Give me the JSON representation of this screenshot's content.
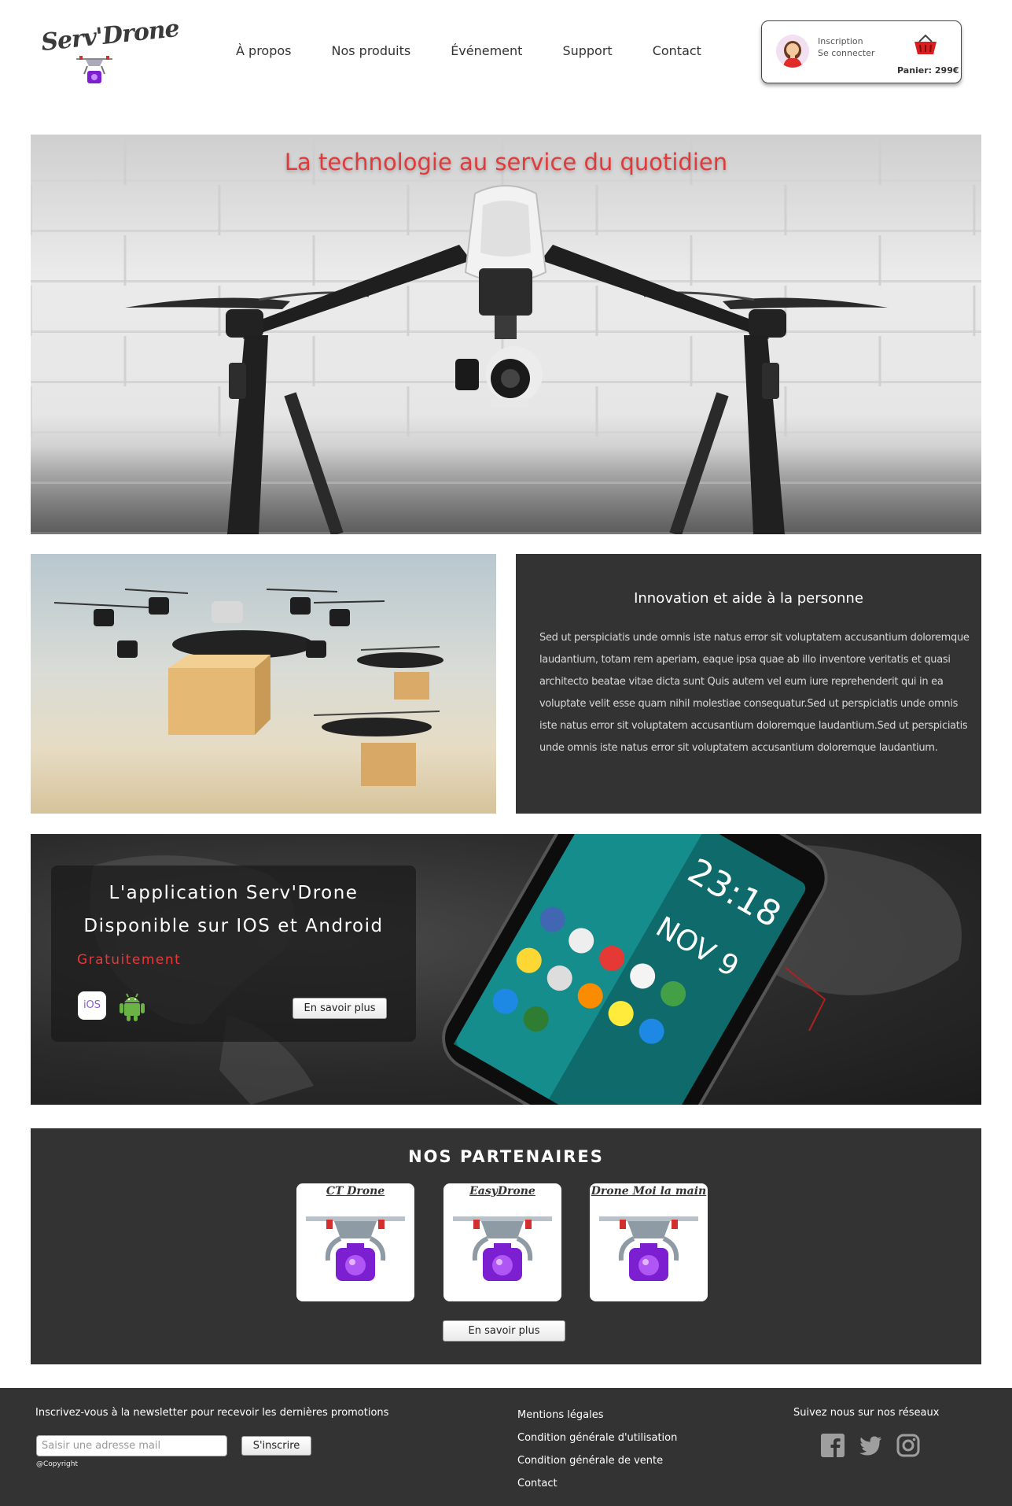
{
  "header": {
    "logo_text": "Serv'Drone",
    "nav": [
      "À propos",
      "Nos produits",
      "Événement",
      "Support",
      "Contact"
    ],
    "account": {
      "signup_label": "Inscription",
      "login_label": "Se connecter",
      "cart_total": "Panier: 299€"
    }
  },
  "hero": {
    "title": "La technologie au service du quotidien"
  },
  "info": {
    "title": "Innovation et aide à la personne",
    "text": "Sed ut perspiciatis unde omnis iste natus error sit voluptatem accusantium doloremque laudantium, totam rem aperiam, eaque ipsa quae ab illo inventore veritatis et quasi architecto beatae vitae dicta sunt Quis autem vel eum iure reprehenderit qui in ea voluptate velit esse quam nihil molestiae consequatur.Sed ut perspiciatis unde omnis iste natus error sit voluptatem accusantium doloremque laudantium.Sed ut perspiciatis unde omnis iste natus error sit voluptatem accusantium doloremque laudantium."
  },
  "app": {
    "line1": "L'application Serv'Drone",
    "line2": "Disponible sur IOS et Android",
    "free": "Gratuitement",
    "ios_label": "iOS",
    "button": "En savoir plus",
    "phone_time": "23:18",
    "phone_date": "NOV 9"
  },
  "partners": {
    "title": "NOS PARTENAIRES",
    "items": [
      "CT Drone",
      "EasyDrone",
      "Drone Moi la main"
    ],
    "button": "En savoir plus"
  },
  "footer": {
    "newsletter_text": "Inscrivez-vous à la newsletter pour recevoir les dernières promotions",
    "newsletter_placeholder": "Saisir une adresse mail",
    "newsletter_button": "S'inscrire",
    "copyright": "@Copyright",
    "links": [
      "Mentions légales",
      "Condition générale d'utilisation",
      "Condition générale de vente",
      "Contact"
    ],
    "social_title": "Suivez nous sur nos réseaux",
    "social_icons": [
      "facebook-icon",
      "twitter-icon",
      "instagram-icon"
    ]
  },
  "colors": {
    "accent_red": "#e23a3a",
    "dark_panel": "#333333",
    "logo_purple": "#6a1bbf"
  }
}
